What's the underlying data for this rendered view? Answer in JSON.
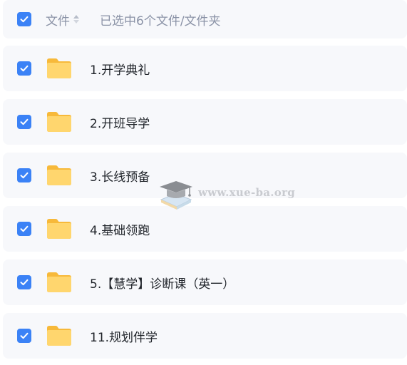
{
  "header": {
    "column_label": "文件",
    "selection_info": "已选中6个文件/文件夹",
    "sort_icon": "sort-updown-icon",
    "all_checked": true
  },
  "items": [
    {
      "label": "1.开学典礼",
      "checked": true,
      "icon": "folder-icon"
    },
    {
      "label": "2.开班导学",
      "checked": true,
      "icon": "folder-icon"
    },
    {
      "label": "3.长线预备",
      "checked": true,
      "icon": "folder-icon"
    },
    {
      "label": "4.基础领跑",
      "checked": true,
      "icon": "folder-icon"
    },
    {
      "label": "5.【慧学】诊断课（英一）",
      "checked": true,
      "icon": "folder-icon"
    },
    {
      "label": "11.规划伴学",
      "checked": true,
      "icon": "folder-icon"
    }
  ],
  "watermark": {
    "text": "www.xue-ba.org",
    "icon": "graduation-cap-icon"
  },
  "colors": {
    "accent": "#3b82f6",
    "row_background": "#f7f8fb",
    "folder": "#ffd267",
    "muted_text": "#8a92a6"
  }
}
